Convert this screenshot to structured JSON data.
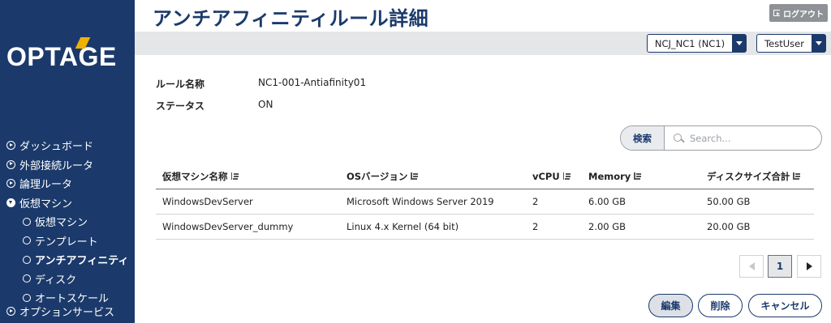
{
  "sidebar": {
    "logo": "OPTAGE",
    "nav": [
      {
        "label": "ダッシュボード"
      },
      {
        "label": "外部接続ルータ"
      },
      {
        "label": "論理ルータ"
      },
      {
        "label": "仮想マシン"
      }
    ],
    "sub_nav": [
      {
        "label": "仮想マシン"
      },
      {
        "label": "テンプレート"
      },
      {
        "label": "アンチアフィニティ"
      },
      {
        "label": "ディスク"
      },
      {
        "label": "オートスケール"
      }
    ],
    "bottom_item": "オプションサービス"
  },
  "header": {
    "title": "アンチアフィニティルール詳細",
    "logout_label": "ログアウト",
    "tenant_select": "NCJ_NC1 (NC1)",
    "user_select": "TestUser"
  },
  "detail": {
    "name_label": "ルール名称",
    "name_value": "NC1-001-Antiafinity01",
    "status_label": "ステータス",
    "status_value": "ON"
  },
  "search": {
    "button_label": "検索",
    "placeholder": "Search..."
  },
  "table": {
    "columns": [
      "仮想マシン名称",
      "OSバージョン",
      "vCPU",
      "Memory",
      "ディスクサイズ合計"
    ],
    "rows": [
      [
        "WindowsDevServer",
        "Microsoft Windows Server 2019",
        "2",
        "6.00 GB",
        "50.00 GB"
      ],
      [
        "WindowsDevServer_dummy",
        "Linux 4.x Kernel (64 bit)",
        "2",
        "2.00 GB",
        "20.00 GB"
      ]
    ]
  },
  "pagination": {
    "current_page": "1"
  },
  "actions": {
    "edit_label": "編集",
    "delete_label": "削除",
    "cancel_label": "キャンセル"
  },
  "colors": {
    "sidebar_bg": "#1b3a6b",
    "logo_accent": "#f0b000",
    "topbar_bg": "#e4e6e8",
    "logout_bg": "#8e9296"
  }
}
